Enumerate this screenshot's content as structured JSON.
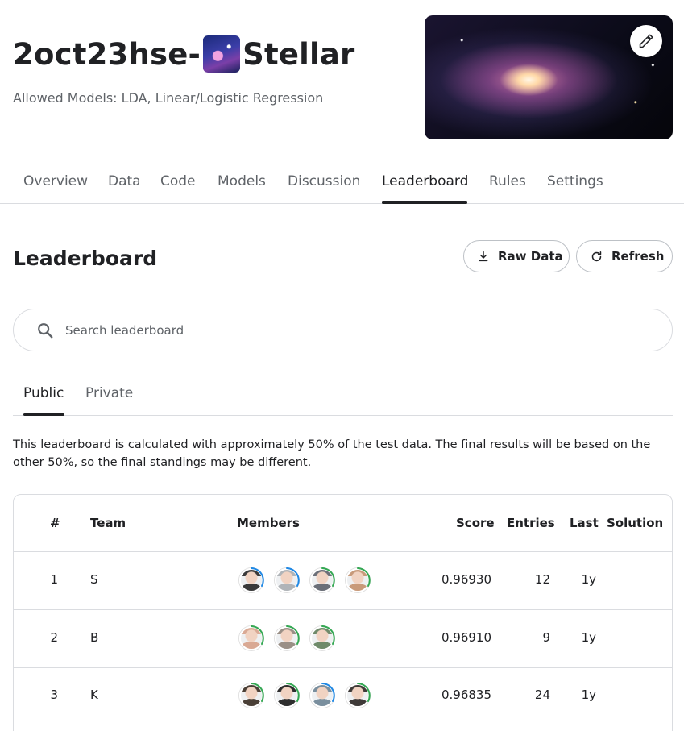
{
  "competition": {
    "title_prefix": "2oct23hse-",
    "title_suffix": "Stellar",
    "subtitle": "Allowed Models: LDA, Linear/Logistic Regression"
  },
  "tabs": [
    "Overview",
    "Data",
    "Code",
    "Models",
    "Discussion",
    "Leaderboard",
    "Rules",
    "Settings"
  ],
  "active_tab": "Leaderboard",
  "leaderboard": {
    "title": "Leaderboard",
    "raw_data_label": "Raw Data",
    "refresh_label": "Refresh",
    "search_placeholder": "Search leaderboard",
    "subtabs": [
      "Public",
      "Private"
    ],
    "active_subtab": "Public",
    "notice": "This leaderboard is calculated with approximately 50% of the test data. The final results will be based on the other 50%, so the final standings may be different.",
    "columns": [
      "#",
      "Team",
      "Members",
      "Score",
      "Entries",
      "Last",
      "Solution"
    ],
    "rows": [
      {
        "rank": "1",
        "team": "S",
        "score": "0.96930",
        "entries": "12",
        "last": "1y",
        "members": [
          "#3a3a3a",
          "#b0b4b8",
          "#6b6f78",
          "#c89a7a"
        ],
        "rings": [
          "#1e88e5",
          "#1e88e5",
          "#34a853",
          "#34a853"
        ]
      },
      {
        "rank": "2",
        "team": "B",
        "score": "0.96910",
        "entries": "9",
        "last": "1y",
        "members": [
          "#d9a994",
          "#9a8f86",
          "#6f8a6a"
        ],
        "rings": [
          "#34a853",
          "#34a853",
          "#34a853"
        ]
      },
      {
        "rank": "3",
        "team": "K",
        "score": "0.96835",
        "entries": "24",
        "last": "1y",
        "members": [
          "#4a3f36",
          "#2e2e2e",
          "#7a8f9e",
          "#3f3a38"
        ],
        "rings": [
          "#34a853",
          "#34a853",
          "#1e88e5",
          "#34a853"
        ]
      }
    ]
  },
  "colors": {
    "text": "#202124",
    "muted": "#5f6368",
    "border": "#dadce0",
    "ring_blue": "#1e88e5",
    "ring_green": "#34a853"
  },
  "icons": {
    "edit": "pencil-icon",
    "download": "download-icon",
    "refresh": "refresh-icon",
    "search": "search-icon"
  }
}
